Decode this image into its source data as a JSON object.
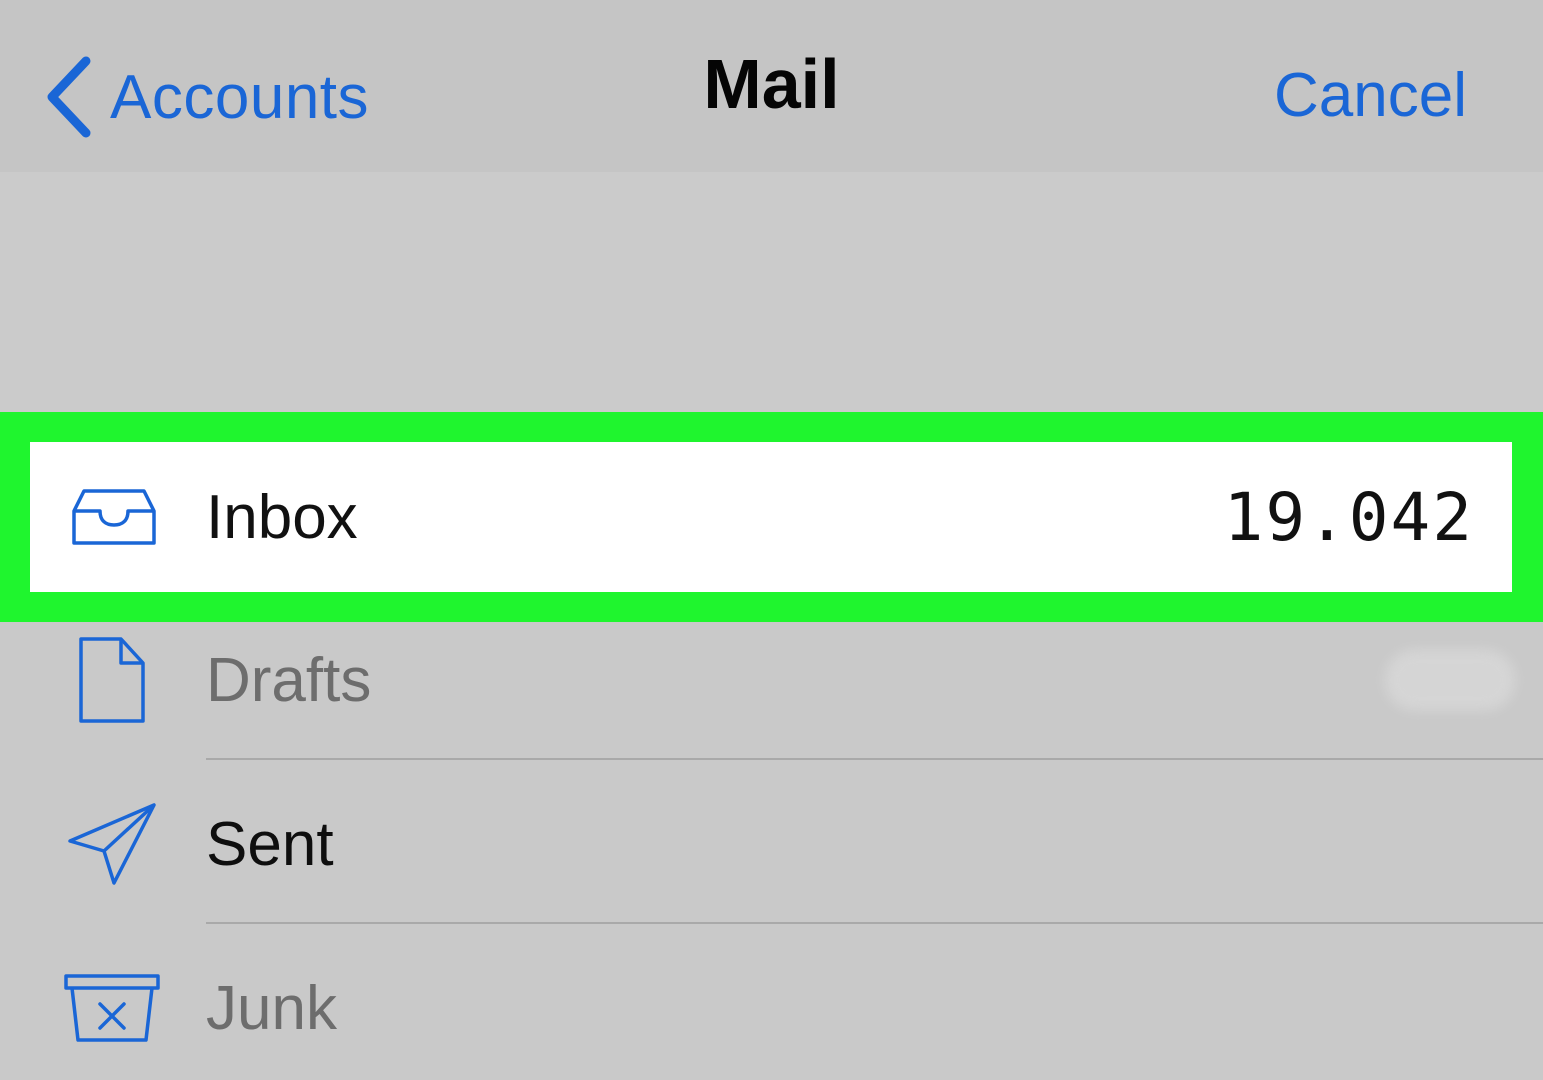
{
  "navbar": {
    "back_label": "Accounts",
    "title": "Mail",
    "cancel_label": "Cancel",
    "accent_color": "#1a66d6",
    "back_icon": "chevron-left-icon"
  },
  "highlight_color": "#1ff52e",
  "mailboxes": [
    {
      "label": "Inbox",
      "count": "19.042",
      "icon": "inbox-tray-icon",
      "highlighted": true
    },
    {
      "label": "Drafts",
      "icon": "document-icon"
    },
    {
      "label": "Sent",
      "icon": "paper-plane-icon"
    },
    {
      "label": "Junk",
      "icon": "junk-bin-icon"
    }
  ]
}
